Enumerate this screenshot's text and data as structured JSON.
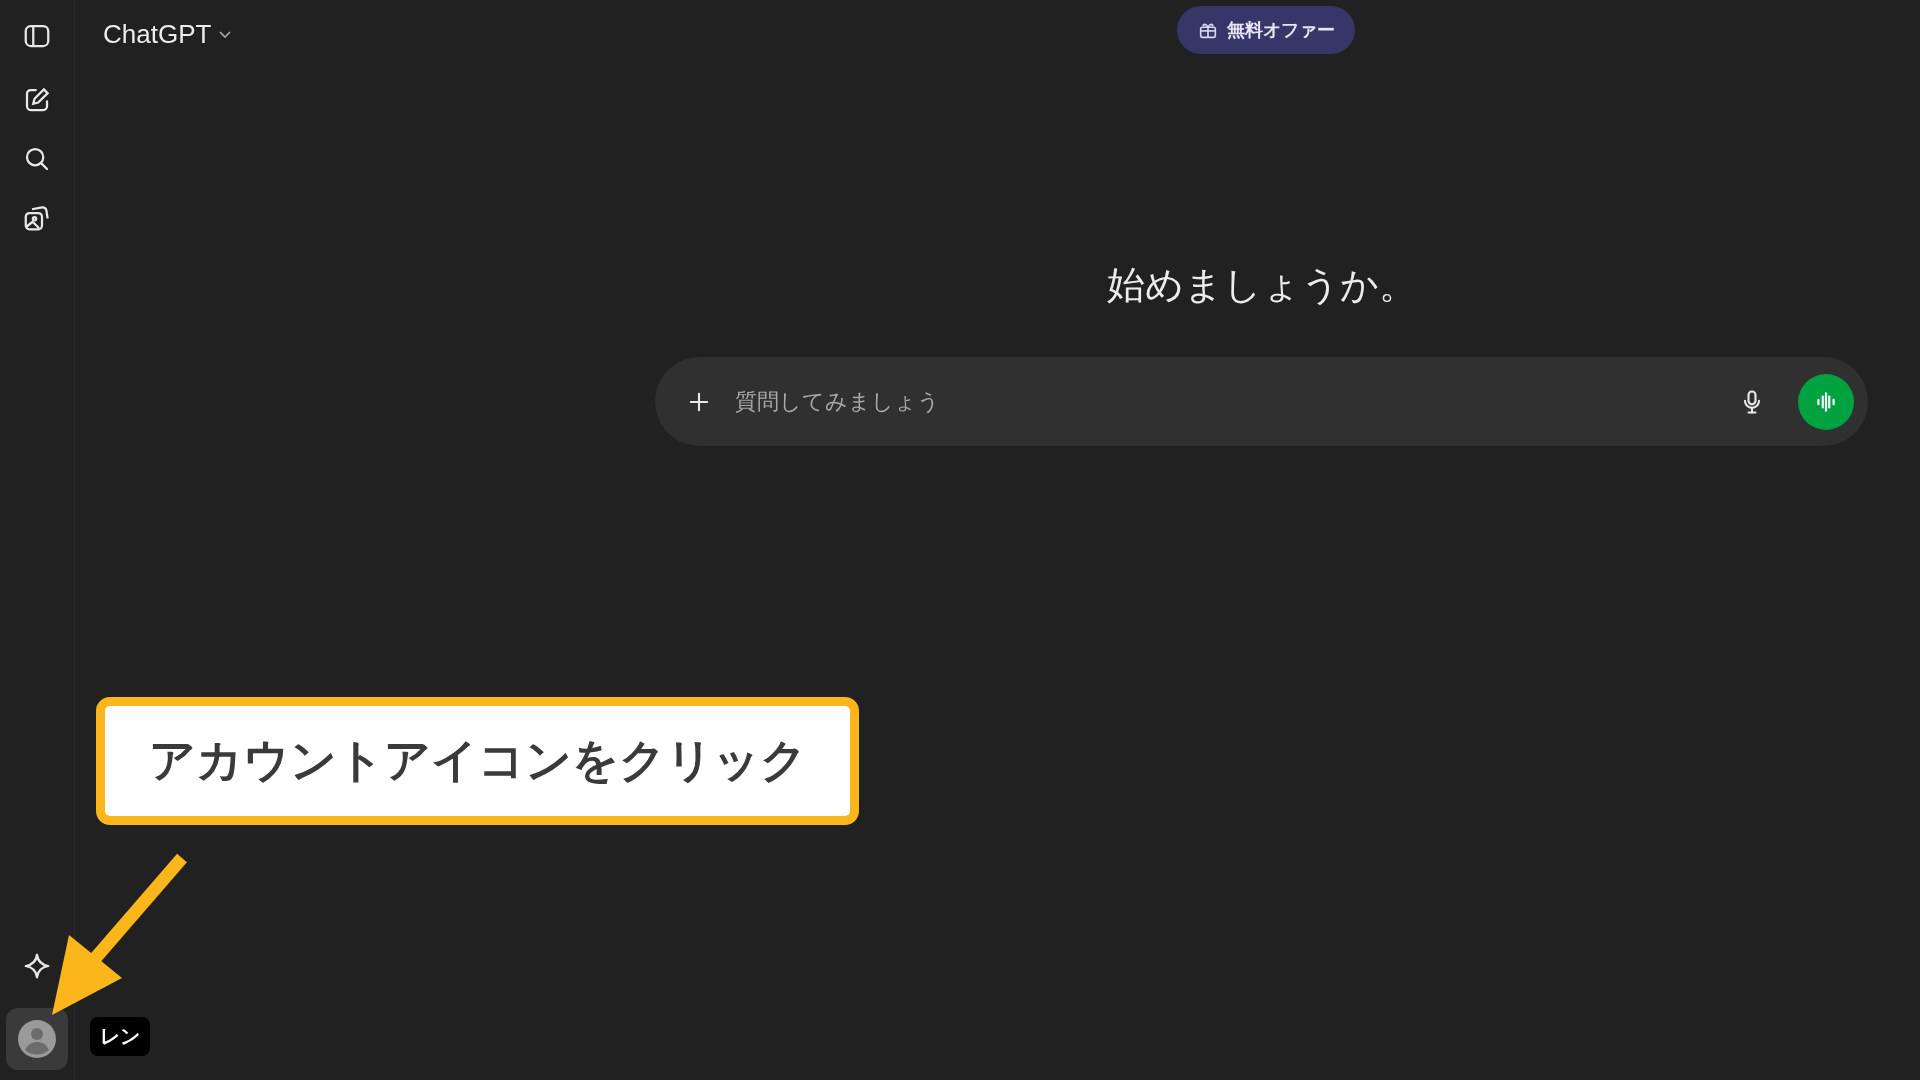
{
  "header": {
    "title": "ChatGPT"
  },
  "offer_badge": {
    "label": "無料オファー"
  },
  "greeting": "始めましょうか。",
  "composer": {
    "placeholder": "質問してみましょう"
  },
  "account": {
    "tooltip": "レン"
  },
  "annotation": {
    "text": "アカウントアイコンをクリック"
  }
}
